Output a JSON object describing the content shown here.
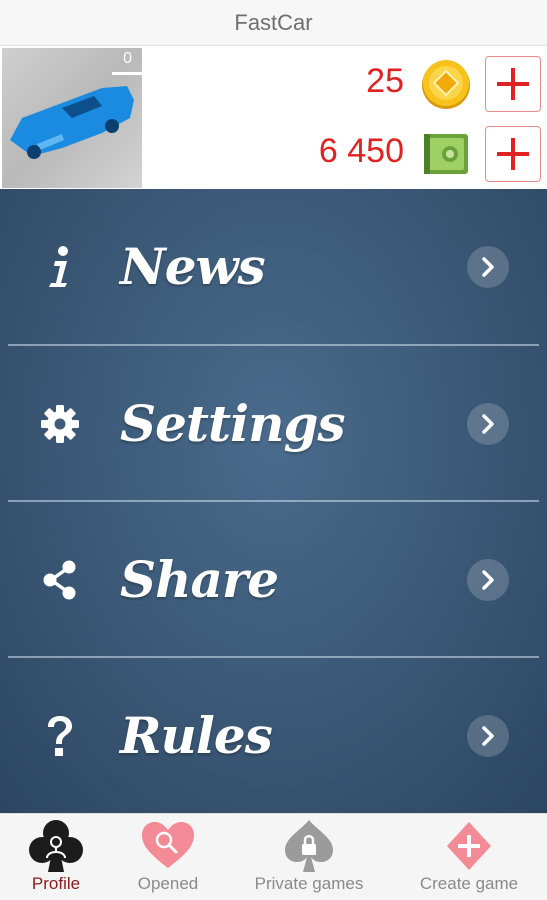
{
  "header": {
    "title": "FastCar"
  },
  "profile": {
    "avatar_counter": "0",
    "coins": "25",
    "cash": "6 450"
  },
  "menu": {
    "items": [
      {
        "label": "News",
        "icon": "info-icon"
      },
      {
        "label": "Settings",
        "icon": "gear-icon"
      },
      {
        "label": "Share",
        "icon": "share-icon"
      },
      {
        "label": "Rules",
        "icon": "question-icon"
      }
    ]
  },
  "bottom_nav": {
    "items": [
      {
        "label": "Profile",
        "icon": "club-profile-icon",
        "active": true
      },
      {
        "label": "Opened",
        "icon": "heart-search-icon",
        "active": false
      },
      {
        "label": "Private games",
        "icon": "spade-lock-icon",
        "active": false
      },
      {
        "label": "Create game",
        "icon": "diamond-plus-icon",
        "active": false
      }
    ]
  },
  "colors": {
    "accent_red": "#e02222",
    "menu_bg": "#3a5775",
    "active_nav": "#8b1a1a",
    "nav_pink": "#f28b96"
  }
}
